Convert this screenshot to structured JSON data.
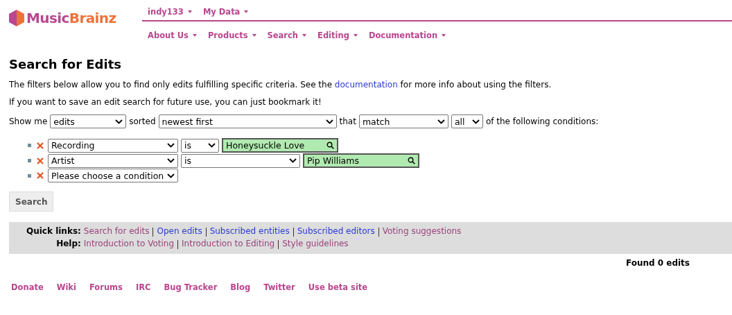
{
  "logo": {
    "part_1": "Music",
    "part_2": "Brainz"
  },
  "user_menu": [
    {
      "label": "indy133"
    },
    {
      "label": "My Data"
    }
  ],
  "main_menu": [
    {
      "label": "About Us"
    },
    {
      "label": "Products"
    },
    {
      "label": "Search"
    },
    {
      "label": "Editing"
    },
    {
      "label": "Documentation"
    }
  ],
  "page": {
    "title": "Search for Edits",
    "intro": "The filters below allow you to find only edits fulfilling specific criteria. See the ",
    "intro_link": "documentation",
    "intro_end": " for more info about using the filters.",
    "bookmark_note": "If you want to save an edit search for future use, you can just bookmark it!"
  },
  "query": [
    {
      "kind": "text",
      "text": "Show me"
    },
    {
      "kind": "select",
      "value": "edits"
    },
    {
      "kind": "text",
      "text": "sorted"
    },
    {
      "kind": "select",
      "value": "newest first"
    },
    {
      "kind": "text",
      "text": "that"
    },
    {
      "kind": "select",
      "value": "match"
    },
    {
      "kind": "select",
      "value": "all"
    },
    {
      "kind": "text",
      "text": "of the following conditions:"
    }
  ],
  "conditions": [
    {
      "field": "Recording",
      "operator": "is",
      "value": "Honeysuckle Love"
    },
    {
      "field": "Artist",
      "operator": "is",
      "value": "Pip Williams"
    },
    {
      "field": "Please choose a condition"
    }
  ],
  "search_button": "Search",
  "quick_links": {
    "label": "Quick links:",
    "links": [
      {
        "text": "Search for edits",
        "visited": true
      },
      {
        "text": "Open edits",
        "visited": false
      },
      {
        "text": "Subscribed entities",
        "visited": false
      },
      {
        "text": "Subscribed editors",
        "visited": false
      },
      {
        "text": "Voting suggestions",
        "visited": true
      }
    ]
  },
  "help": {
    "label": "Help:",
    "links": [
      {
        "text": "Introduction to Voting",
        "visited": true
      },
      {
        "text": "Introduction to Editing",
        "visited": true
      },
      {
        "text": "Style guidelines",
        "visited": true
      }
    ]
  },
  "results": "Found 0 edits",
  "footer": [
    {
      "label": "Donate"
    },
    {
      "label": "Wiki"
    },
    {
      "label": "Forums"
    },
    {
      "label": "IRC"
    },
    {
      "label": "Bug Tracker"
    },
    {
      "label": "Blog"
    },
    {
      "label": "Twitter"
    },
    {
      "label": "Use beta site"
    }
  ]
}
